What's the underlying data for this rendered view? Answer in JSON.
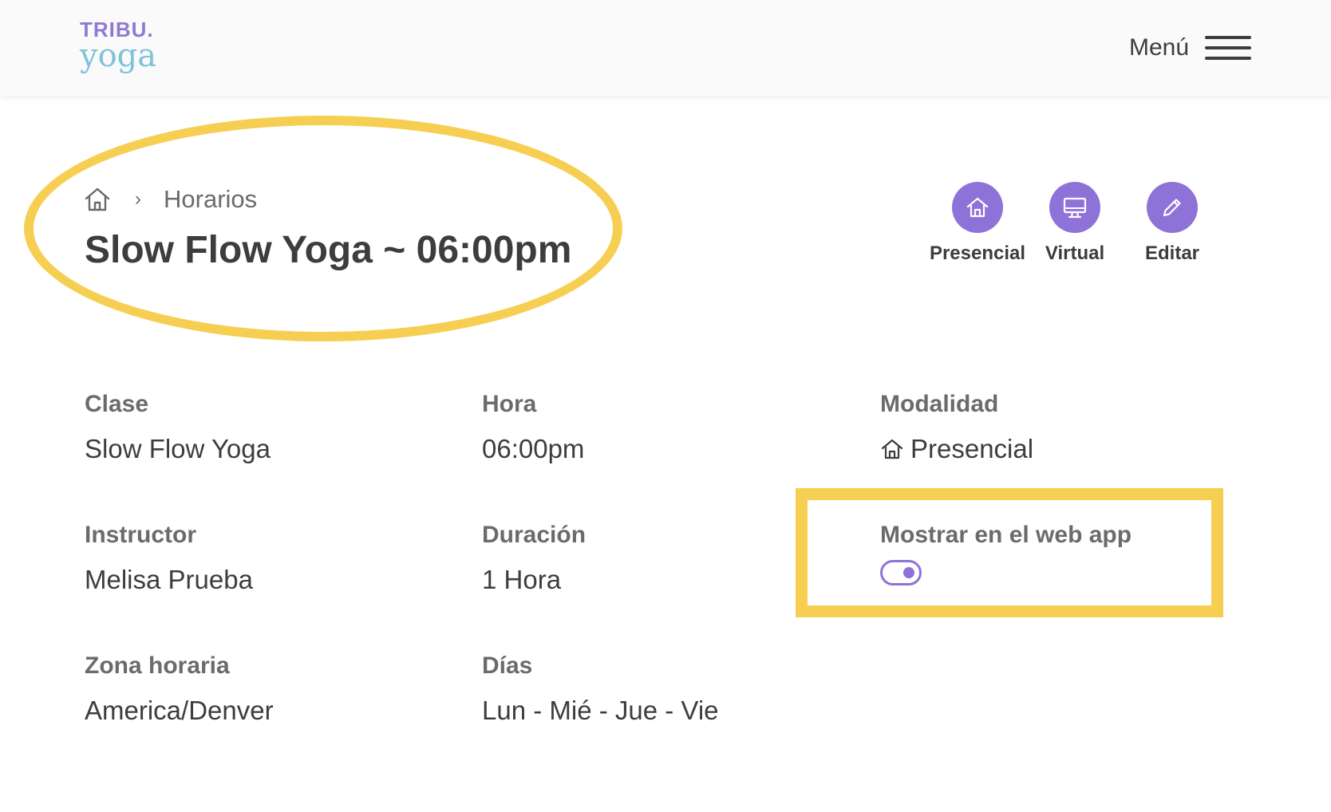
{
  "header": {
    "logo_top": "TRIBU.",
    "logo_bottom": "yoga",
    "menu_label": "Menú"
  },
  "breadcrumb": {
    "separator": "›",
    "current": "Horarios"
  },
  "page_title": "Slow Flow Yoga ~ 06:00pm",
  "actions": {
    "presencial": "Presencial",
    "virtual": "Virtual",
    "editar": "Editar"
  },
  "details": {
    "clase": {
      "label": "Clase",
      "value": "Slow Flow Yoga"
    },
    "hora": {
      "label": "Hora",
      "value": "06:00pm"
    },
    "modalidad": {
      "label": "Modalidad",
      "value": "Presencial"
    },
    "instructor": {
      "label": "Instructor",
      "value": "Melisa Prueba"
    },
    "duracion": {
      "label": "Duración",
      "value": "1 Hora"
    },
    "mostrar": {
      "label": "Mostrar en el web app",
      "enabled": true
    },
    "zona": {
      "label": "Zona horaria",
      "value": "America/Denver"
    },
    "dias": {
      "label": "Días",
      "value": "Lun - Mié - Jue - Vie"
    }
  },
  "colors": {
    "accent": "#8f72d8",
    "highlight": "#f6cf52",
    "logo_purple": "#8e7ad6",
    "logo_blue": "#7fc3d9"
  }
}
